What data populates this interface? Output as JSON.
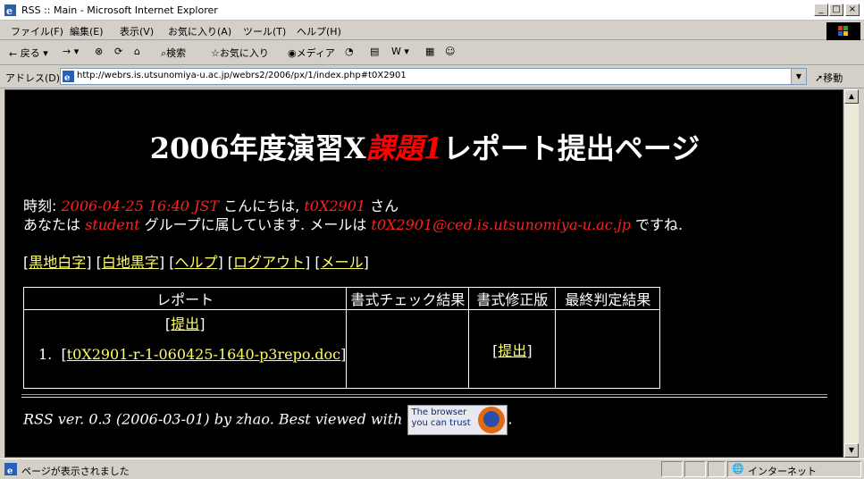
{
  "window": {
    "title": "RSS :: Main - Microsoft Internet Explorer"
  },
  "menu": [
    "ファイル(F)",
    "編集(E)",
    "表示(V)",
    "お気に入り(A)",
    "ツール(T)",
    "ヘルプ(H)"
  ],
  "toolbar": {
    "back": "戻る",
    "search": "検索",
    "favorites": "お気に入り",
    "media": "メディア"
  },
  "address": {
    "label": "アドレス(D)",
    "url": "http://webrs.is.utsunomiya-u.ac.jp/webrs2/2006/px/1/index.php#t0X2901",
    "go": "移動"
  },
  "page": {
    "heading_pre": "2006年度演習X",
    "heading_em": "課題1",
    "heading_post": "レポート提出ページ",
    "time_label": "時刻:",
    "time_value": "2006-04-25 16:40 JST",
    "greeting": "こんにちは,",
    "user": "t0X2901",
    "san": "さん",
    "you_are": "あなたは",
    "group": "student",
    "group_text": "グループに属しています. メールは",
    "email": "t0X2901@ced.is.utsunomiya-u.ac.jp",
    "desune": "ですね.",
    "nav_links": [
      "黒地白字",
      "白地黒字",
      "ヘルプ",
      "ログアウト",
      "メール"
    ],
    "table": {
      "headers": [
        "レポート",
        "書式チェック結果",
        "書式修正版",
        "最終判定結果"
      ],
      "submit_label": "提出",
      "item_number": "1.",
      "file_link": "t0X2901-r-1-060425-1640-p3repo.doc",
      "fix_submit_label": "提出"
    },
    "footer": "RSS ver. 0.3 (2006-03-01) by zhao. Best viewed with",
    "badge_line1": "The browser",
    "badge_line2": "you can trust"
  },
  "status": {
    "text": "ページが表示されました",
    "zone": "インターネット"
  }
}
